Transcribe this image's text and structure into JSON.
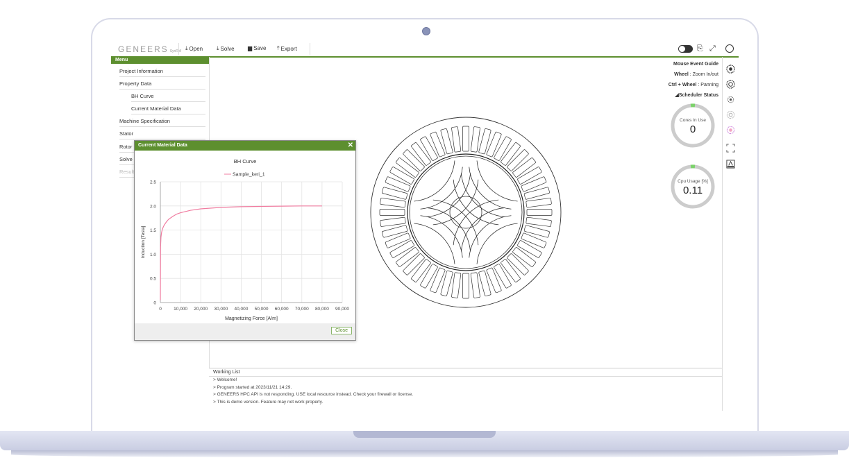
{
  "app": {
    "logo": "GENEERS",
    "logo_sub": "SynRM"
  },
  "toolbar": {
    "open_label": "Open",
    "solve_label": "Solve",
    "save_label": "Save",
    "export_label": "Export"
  },
  "menu": {
    "title": "Menu",
    "items": [
      {
        "label": "Project Information"
      },
      {
        "label": "Property Data"
      },
      {
        "label": "BH Curve"
      },
      {
        "label": "Current Material Data"
      },
      {
        "label": "Machine Specification"
      },
      {
        "label": "Stator"
      },
      {
        "label": "Rotor"
      },
      {
        "label": "Solve"
      },
      {
        "label": "Result"
      }
    ]
  },
  "mouse_guide": {
    "title": "Mouse Event Guide",
    "wheel_key": "Wheel",
    "wheel_desc": ": Zoom In/out",
    "ctrl_key": "Ctrl + Wheel",
    "ctrl_desc": ": Panning",
    "scheduler": "Scheduler Status"
  },
  "gauges": {
    "cores_label": "Cores In Use",
    "cores_value": "0",
    "cpu_label": "Cpu Usage [%]",
    "cpu_value": "0.11"
  },
  "working_list": {
    "title": "Working List",
    "lines": [
      ">   Welcome!",
      ">   Program started at 2023/11/21 14:29.",
      ">   GENEERS HPC API is not responding. USE local resource instead. Check your firewall or license.",
      ">   This is demo version. Feature may not work properly."
    ]
  },
  "dialog": {
    "title": "Current Material Data",
    "close_label": "Close"
  },
  "chart_data": {
    "type": "line",
    "title": "BH Curve",
    "xlabel": "Magnetizing Force [A/m]",
    "ylabel": "Induction [Tesla]",
    "xlim": [
      0,
      90000
    ],
    "ylim": [
      0,
      2.5
    ],
    "x_ticks": [
      "0",
      "10,000",
      "20,000",
      "30,000",
      "40,000",
      "50,000",
      "60,000",
      "70,000",
      "80,000",
      "90,000"
    ],
    "y_ticks": [
      "0",
      "0.5",
      "1.0",
      "1.5",
      "2.0",
      "2.5"
    ],
    "grid": true,
    "legend": "top-center",
    "series": [
      {
        "name": "Sample_keri_1",
        "color": "#f07ca0",
        "x": [
          0,
          100,
          300,
          600,
          1000,
          1500,
          2000,
          3000,
          4000,
          6000,
          8000,
          10000,
          15000,
          20000,
          30000,
          40000,
          50000,
          60000,
          70000,
          80000
        ],
        "y": [
          0.05,
          1.15,
          1.35,
          1.45,
          1.52,
          1.57,
          1.61,
          1.67,
          1.72,
          1.78,
          1.83,
          1.86,
          1.91,
          1.94,
          1.97,
          1.985,
          1.99,
          1.995,
          2.0,
          2.0
        ]
      }
    ]
  }
}
